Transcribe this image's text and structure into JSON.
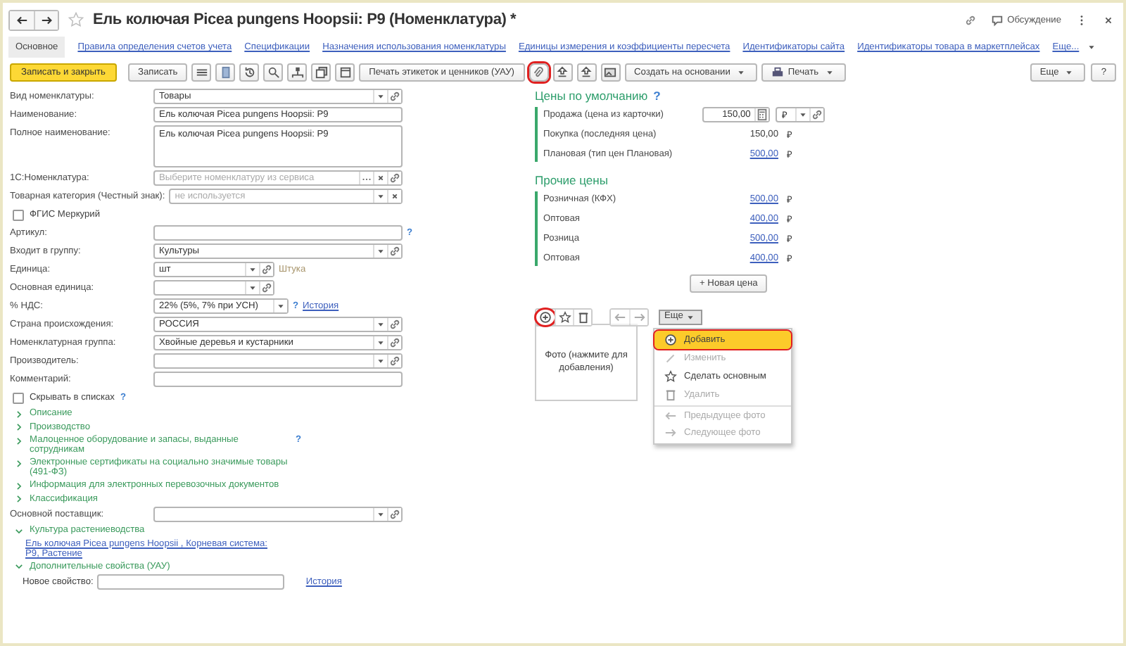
{
  "window": {
    "title": "Ель колючая Picea pungens Hoopsii: P9 (Номенклатура) *",
    "discussion": "Обсуждение"
  },
  "tabs": [
    {
      "kind": "tab",
      "label": "Основное",
      "selected": true
    },
    {
      "kind": "tab",
      "label": "Правила определения счетов учета",
      "selected": false
    },
    {
      "kind": "tab",
      "label": "Спецификации",
      "selected": false
    },
    {
      "kind": "tab",
      "label": "Назначения использования номенклатуры",
      "selected": false
    },
    {
      "kind": "tab",
      "label": "Единицы измерения и коэффициенты пересчета",
      "selected": false
    },
    {
      "kind": "tab",
      "label": "Идентификаторы сайта",
      "selected": false
    },
    {
      "kind": "tab",
      "label": "Идентификаторы товара в маркетплейсах",
      "selected": false
    },
    {
      "kind": "more",
      "label": "Еще...",
      "selected": false
    }
  ],
  "toolbar": [
    {
      "kind": "primary",
      "label": "Записать и закрыть",
      "highlighted": false
    },
    {
      "kind": "button",
      "label": "Записать",
      "highlighted": false
    },
    {
      "kind": "icon",
      "highlighted": false
    },
    {
      "kind": "icon",
      "highlighted": false
    },
    {
      "kind": "icon",
      "highlighted": false
    },
    {
      "kind": "icon",
      "highlighted": false
    },
    {
      "kind": "icon",
      "highlighted": false
    },
    {
      "kind": "icon",
      "highlighted": false
    },
    {
      "kind": "icon",
      "highlighted": false
    },
    {
      "kind": "button",
      "label": "Печать этикеток и ценников (УАУ)",
      "highlighted": false
    },
    {
      "kind": "icon",
      "highlighted": true
    },
    {
      "kind": "icon",
      "highlighted": false
    },
    {
      "kind": "icon",
      "highlighted": false
    },
    {
      "kind": "icon",
      "highlighted": false
    },
    {
      "kind": "menu",
      "label": "Создать на основании",
      "highlighted": false
    },
    {
      "kind": "print",
      "label": "Печать",
      "highlighted": false
    }
  ],
  "toolbar_right": [
    {
      "kind": "menu",
      "label": "Еще"
    },
    {
      "kind": "button",
      "label": "?"
    }
  ],
  "form": [
    {
      "kind": "reference",
      "label": "Вид номенклатуры:",
      "value": "Товары"
    },
    {
      "kind": "string",
      "label": "Наименование:",
      "value": "Ель колючая Picea pungens Hoopsii: P9"
    },
    {
      "kind": "text",
      "label": "Полное наименование:",
      "value": "Ель колючая Picea pungens Hoopsii: P9"
    },
    {
      "kind": "reference",
      "label": "1С:Номенклатура:",
      "placeholder": "Выберите номенклатуру из сервиса"
    },
    {
      "kind": "reference",
      "label": "Товарная категория (Честный знак):",
      "placeholder": "не используется"
    },
    {
      "kind": "checkbox",
      "label": "ФГИС Меркурий",
      "checked": false
    },
    {
      "kind": "string",
      "label": "Артикул:",
      "help": "?"
    },
    {
      "kind": "reference",
      "label": "Входит в группу:",
      "value": "Культуры"
    },
    {
      "kind": "unit",
      "label": "Единица:",
      "value": "шт",
      "note": "Штука"
    },
    {
      "kind": "unit",
      "label": "Основная единица:"
    },
    {
      "kind": "rate",
      "label": "% НДС:",
      "value": "22% (5%, 7% при УСН)",
      "help": "?",
      "link": "История"
    },
    {
      "kind": "reference",
      "label": "Страна происхождения:",
      "value": "РОССИЯ"
    },
    {
      "kind": "reference",
      "label": "Номенклатурная группа:",
      "value": "Хвойные деревья и кустарники"
    },
    {
      "kind": "reference",
      "label": "Производитель:"
    },
    {
      "kind": "string",
      "label": "Комментарий:"
    },
    {
      "kind": "checkbox",
      "label": "Скрывать в списках",
      "checked": false,
      "help": "?"
    },
    {
      "kind": "group",
      "label": "Описание",
      "expanded": false
    },
    {
      "kind": "group",
      "label": "Производство",
      "expanded": false
    },
    {
      "kind": "group",
      "label": "Малоценное оборудование и запасы, выданные сотрудникам",
      "expanded": false,
      "help": "?"
    },
    {
      "kind": "group",
      "label": "Электронные сертификаты на социально значимые товары (491-ФЗ)",
      "expanded": false
    },
    {
      "kind": "group",
      "label": "Информация для электронных перевозочных документов",
      "expanded": false
    },
    {
      "kind": "group",
      "label": "Классификация",
      "expanded": false
    },
    {
      "kind": "reference",
      "label": "Основной поставщик:"
    },
    {
      "kind": "group",
      "label": "Культура растениеводства",
      "expanded": true,
      "link": "Ель колючая Picea pungens Hoopsii , Корневая система: P9, Растение"
    },
    {
      "kind": "group",
      "label": "Дополнительные свойства (УАУ)",
      "expanded": true,
      "property": {
        "label": "Новое свойство:",
        "link": "История"
      }
    }
  ],
  "prices": {
    "default_title": "Цены по умолчанию",
    "help": "?",
    "default": [
      {
        "kind": "input",
        "label": "Продажа (цена из карточки)",
        "value": "150,00",
        "currency": "₽"
      },
      {
        "kind": "plain",
        "label": "Покупка (последняя цена)",
        "value": "150,00",
        "currency": "₽"
      },
      {
        "kind": "link",
        "label": "Плановая (тип цен Плановая)",
        "value": "500,00",
        "currency": "₽"
      }
    ],
    "other_title": "Прочие цены",
    "other": [
      {
        "kind": "link",
        "label": "Розничная (КФХ)",
        "value": "500,00",
        "currency": "₽"
      },
      {
        "kind": "link",
        "label": "Оптовая",
        "value": "400,00",
        "currency": "₽"
      },
      {
        "kind": "link",
        "label": "Розница",
        "value": "500,00",
        "currency": "₽"
      },
      {
        "kind": "link",
        "label": "Оптовая",
        "value": "400,00",
        "currency": "₽"
      }
    ],
    "new_price": "+ Новая цена"
  },
  "photo": {
    "toolbar": [
      {
        "highlighted": true,
        "disabled": false
      },
      {
        "highlighted": false,
        "disabled": false
      },
      {
        "highlighted": false,
        "disabled": false
      },
      {
        "highlighted": false,
        "disabled": true
      },
      {
        "highlighted": false,
        "disabled": true
      }
    ],
    "more": "Еще",
    "placeholder": "Фото (нажмите для добавления)",
    "menu": [
      {
        "label": "Добавить",
        "selected": true,
        "disabled": false,
        "separator_before": false
      },
      {
        "label": "Изменить",
        "selected": false,
        "disabled": true,
        "separator_before": false
      },
      {
        "label": "Сделать основным",
        "selected": false,
        "disabled": false,
        "separator_before": false
      },
      {
        "label": "Удалить",
        "selected": false,
        "disabled": true,
        "separator_before": false
      },
      {
        "label": "Предыдущее фото",
        "selected": false,
        "disabled": true,
        "separator_before": true
      },
      {
        "label": "Следующее фото",
        "selected": false,
        "disabled": true,
        "separator_before": false
      }
    ]
  }
}
